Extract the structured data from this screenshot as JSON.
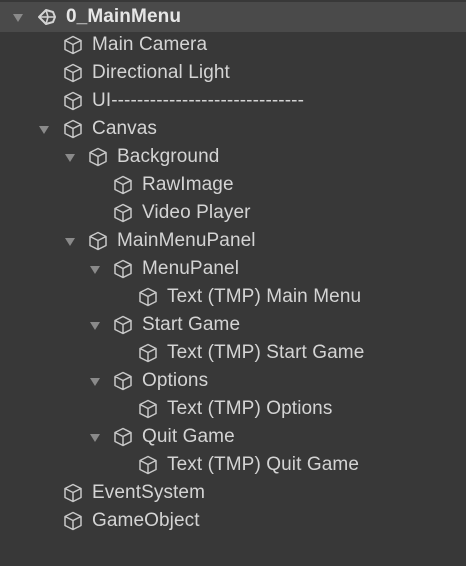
{
  "scene": {
    "name": "0_MainMenu",
    "icon": "unity-scene-icon",
    "expanded": true
  },
  "items": [
    {
      "label": "Main Camera",
      "icon": "gameobject-cube-icon",
      "expanded": null
    },
    {
      "label": "Directional Light",
      "icon": "gameobject-cube-icon",
      "expanded": null
    },
    {
      "label": "UI------------------------------",
      "icon": "gameobject-cube-icon",
      "expanded": null
    },
    {
      "label": "Canvas",
      "icon": "gameobject-cube-icon",
      "expanded": true
    },
    {
      "label": "Background",
      "icon": "gameobject-cube-icon",
      "expanded": true
    },
    {
      "label": "RawImage",
      "icon": "gameobject-cube-icon",
      "expanded": null
    },
    {
      "label": "Video Player",
      "icon": "gameobject-cube-icon",
      "expanded": null
    },
    {
      "label": "MainMenuPanel",
      "icon": "gameobject-cube-icon",
      "expanded": true
    },
    {
      "label": "MenuPanel",
      "icon": "gameobject-cube-icon",
      "expanded": true
    },
    {
      "label": "Text (TMP) Main Menu",
      "icon": "gameobject-cube-icon",
      "expanded": null
    },
    {
      "label": "Start Game",
      "icon": "gameobject-cube-icon",
      "expanded": true
    },
    {
      "label": "Text (TMP) Start Game",
      "icon": "gameobject-cube-icon",
      "expanded": null
    },
    {
      "label": "Options",
      "icon": "gameobject-cube-icon",
      "expanded": true
    },
    {
      "label": "Text (TMP) Options",
      "icon": "gameobject-cube-icon",
      "expanded": null
    },
    {
      "label": "Quit Game",
      "icon": "gameobject-cube-icon",
      "expanded": true
    },
    {
      "label": "Text (TMP) Quit Game",
      "icon": "gameobject-cube-icon",
      "expanded": null
    },
    {
      "label": "EventSystem",
      "icon": "gameobject-cube-icon",
      "expanded": null
    },
    {
      "label": "GameObject",
      "icon": "gameobject-cube-icon",
      "expanded": null
    }
  ]
}
